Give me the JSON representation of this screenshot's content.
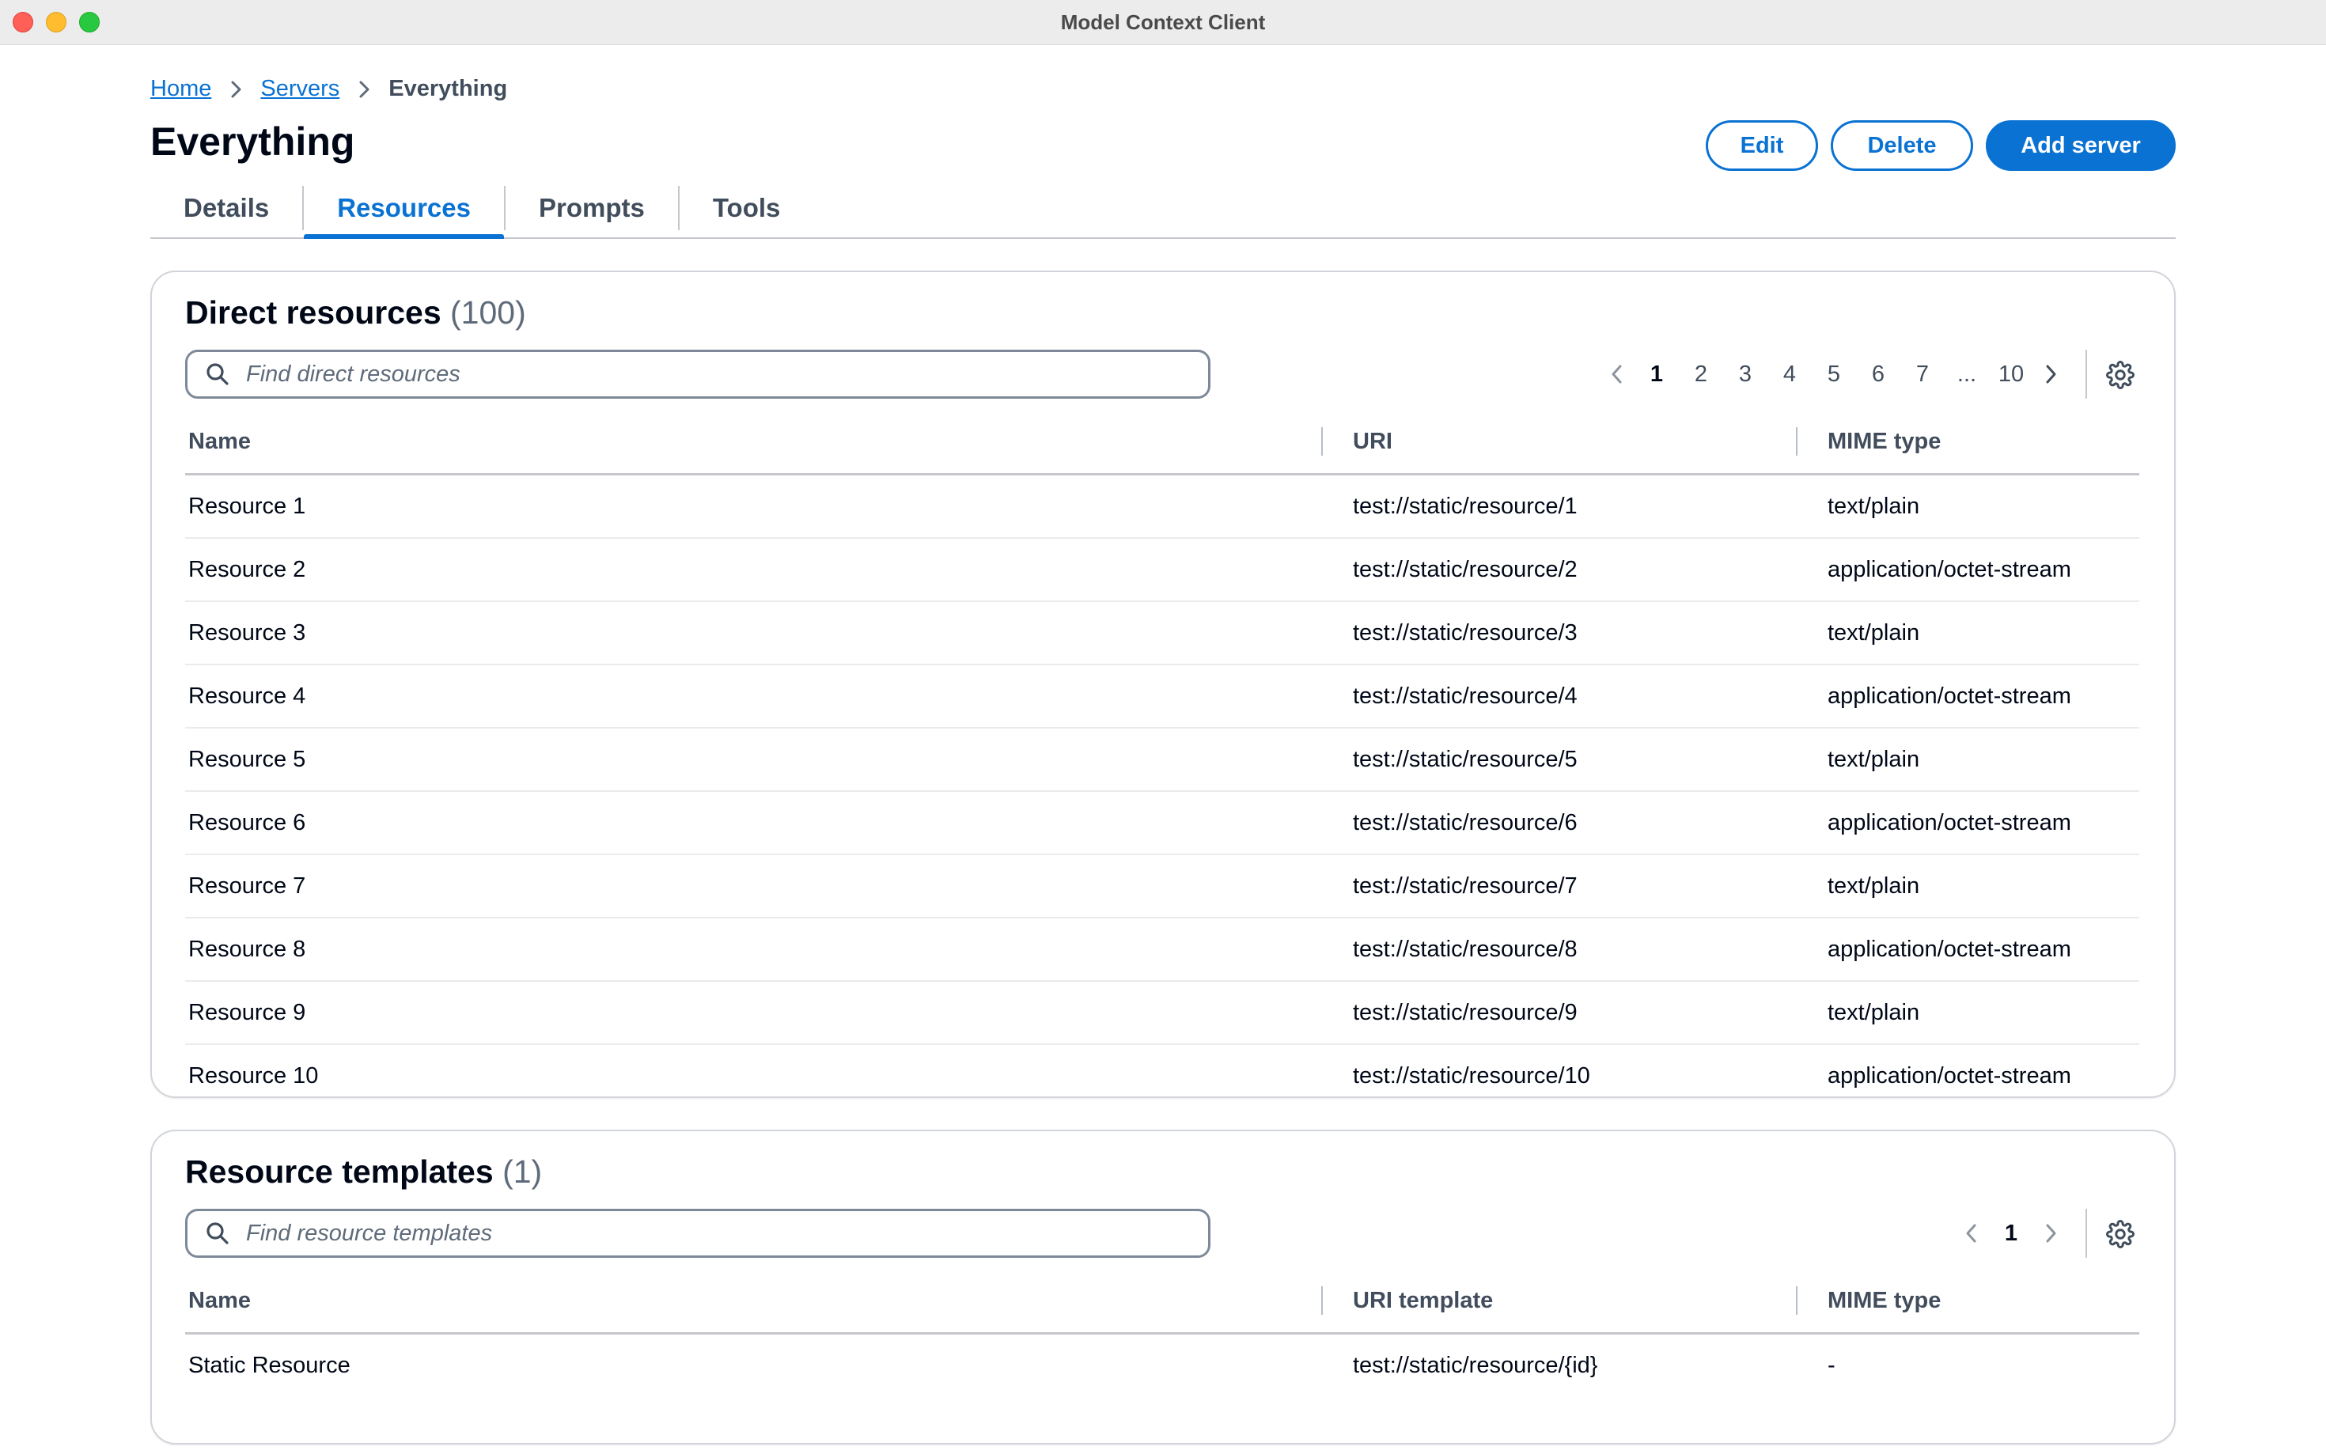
{
  "window": {
    "title": "Model Context Client"
  },
  "breadcrumb": {
    "home": "Home",
    "servers": "Servers",
    "current": "Everything"
  },
  "page": {
    "title": "Everything"
  },
  "actions": {
    "edit": "Edit",
    "delete": "Delete",
    "add_server": "Add server"
  },
  "tabs": [
    {
      "label": "Details",
      "active": false
    },
    {
      "label": "Resources",
      "active": true
    },
    {
      "label": "Prompts",
      "active": false
    },
    {
      "label": "Tools",
      "active": false
    }
  ],
  "direct_resources": {
    "title": "Direct resources",
    "count": "(100)",
    "search_placeholder": "Find direct resources",
    "pagination": {
      "pages": [
        "1",
        "2",
        "3",
        "4",
        "5",
        "6",
        "7"
      ],
      "ellipsis": "...",
      "last": "10",
      "current": "1"
    },
    "columns": {
      "name": "Name",
      "uri": "URI",
      "mime": "MIME type"
    },
    "rows": [
      {
        "name": "Resource 1",
        "uri": "test://static/resource/1",
        "mime": "text/plain"
      },
      {
        "name": "Resource 2",
        "uri": "test://static/resource/2",
        "mime": "application/octet-stream"
      },
      {
        "name": "Resource 3",
        "uri": "test://static/resource/3",
        "mime": "text/plain"
      },
      {
        "name": "Resource 4",
        "uri": "test://static/resource/4",
        "mime": "application/octet-stream"
      },
      {
        "name": "Resource 5",
        "uri": "test://static/resource/5",
        "mime": "text/plain"
      },
      {
        "name": "Resource 6",
        "uri": "test://static/resource/6",
        "mime": "application/octet-stream"
      },
      {
        "name": "Resource 7",
        "uri": "test://static/resource/7",
        "mime": "text/plain"
      },
      {
        "name": "Resource 8",
        "uri": "test://static/resource/8",
        "mime": "application/octet-stream"
      },
      {
        "name": "Resource 9",
        "uri": "test://static/resource/9",
        "mime": "text/plain"
      },
      {
        "name": "Resource 10",
        "uri": "test://static/resource/10",
        "mime": "application/octet-stream"
      }
    ]
  },
  "resource_templates": {
    "title": "Resource templates",
    "count": "(1)",
    "search_placeholder": "Find resource templates",
    "pagination": {
      "current": "1"
    },
    "columns": {
      "name": "Name",
      "uri": "URI template",
      "mime": "MIME type"
    },
    "rows": [
      {
        "name": "Static Resource",
        "uri": "test://static/resource/{id}",
        "mime": "-"
      }
    ]
  },
  "colors": {
    "accent": "#0972d3",
    "text": "#000716",
    "muted": "#414d5c",
    "border": "#c6c6cd"
  }
}
